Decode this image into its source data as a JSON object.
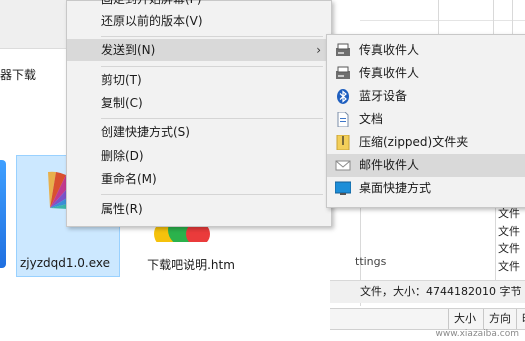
{
  "background": {
    "left_title": "器下载",
    "settings_fragment": "ttings",
    "list_items": [
      "文件",
      "文件",
      "文件",
      "文件"
    ],
    "status_text": "文件，大小：4744182010 字节",
    "columns": [
      "大小",
      "方向",
      "时"
    ],
    "watermark": "www.xiazaiba.com"
  },
  "files": [
    {
      "name": "zjyzdqd1.0.exe",
      "selected": true
    },
    {
      "name": "下载吧说明.htm",
      "selected": false
    }
  ],
  "context_menu": {
    "partial_top": "固定到开始屏幕(P)",
    "items": [
      {
        "label": "还原以前的版本(V)"
      },
      {
        "label": "发送到(N)",
        "has_submenu": true,
        "highlighted": true
      },
      {
        "label": "剪切(T)"
      },
      {
        "label": "复制(C)"
      },
      {
        "label": "创建快捷方式(S)"
      },
      {
        "label": "删除(D)"
      },
      {
        "label": "重命名(M)"
      },
      {
        "label": "属性(R)"
      }
    ]
  },
  "submenu": {
    "items": [
      {
        "label": "传真收件人",
        "icon": "fax-icon"
      },
      {
        "label": "传真收件人",
        "icon": "fax-icon"
      },
      {
        "label": "蓝牙设备",
        "icon": "bluetooth-icon"
      },
      {
        "label": "文档",
        "icon": "document-icon"
      },
      {
        "label": "压缩(zipped)文件夹",
        "icon": "zip-folder-icon"
      },
      {
        "label": "邮件收件人",
        "icon": "mail-icon",
        "highlighted": true
      },
      {
        "label": "桌面快捷方式",
        "icon": "desktop-icon"
      }
    ]
  },
  "colors": {
    "menu_bg": "#f2f2f2",
    "menu_hover": "#d9d9d9",
    "selection_bg": "#cce8ff",
    "bluetooth": "#1f5fbf"
  }
}
